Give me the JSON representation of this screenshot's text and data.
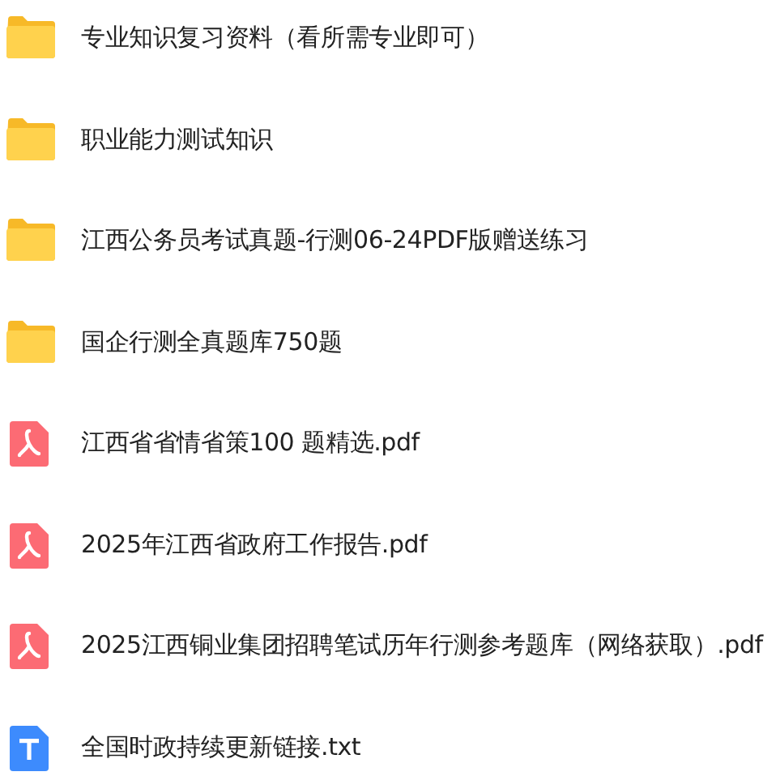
{
  "files": [
    {
      "kind": "folder",
      "name": "专业知识复习资料（看所需专业即可）"
    },
    {
      "kind": "folder",
      "name": "职业能力测试知识"
    },
    {
      "kind": "folder",
      "name": "江西公务员考试真题-行测06-24PDF版赠送练习"
    },
    {
      "kind": "folder",
      "name": "国企行测全真题库750题"
    },
    {
      "kind": "pdf",
      "name": "江西省省情省策100 题精选.pdf"
    },
    {
      "kind": "pdf",
      "name": "2025年江西省政府工作报告.pdf"
    },
    {
      "kind": "pdf",
      "name": "2025江西铜业集团招聘笔试历年行测参考题库（网络获取）.pdf"
    },
    {
      "kind": "txt",
      "name": "全国时政持续更新链接.txt"
    }
  ]
}
